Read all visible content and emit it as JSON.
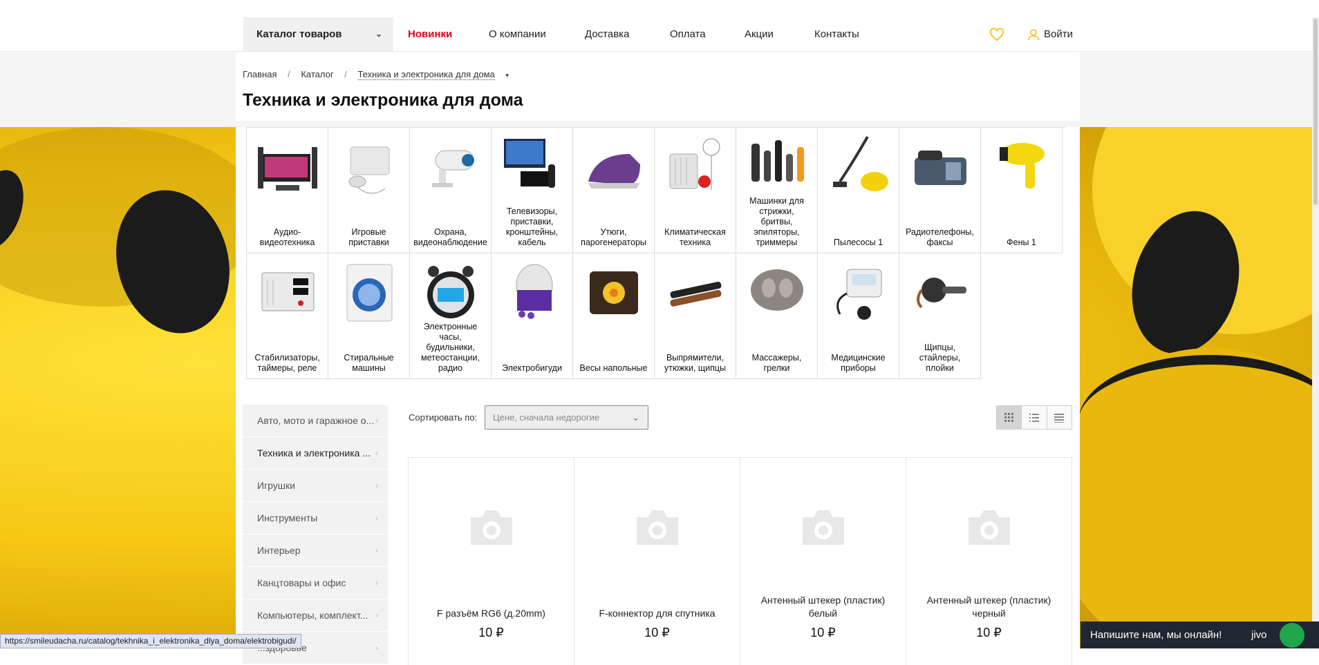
{
  "nav": {
    "catalog_button": "Каталог товаров",
    "links": [
      "Новинки",
      "О компании",
      "Доставка",
      "Оплата",
      "Акции",
      "Контакты"
    ],
    "login": "Войти"
  },
  "breadcrumb": [
    "Главная",
    "Каталог",
    "Техника и электроника для дома"
  ],
  "page_title": "Техника и электроника для дома",
  "categories": [
    {
      "label": "Аудио-\nвидеотехника",
      "icon": "audio-video-icon"
    },
    {
      "label": "Игровые\nприставки",
      "icon": "game-console-icon"
    },
    {
      "label": "Охрана,\nвидеонаблюдение",
      "icon": "security-camera-icon"
    },
    {
      "label": "Телевизоры,\nприставки,\nкронштейны,\nкабель",
      "icon": "tv-icon"
    },
    {
      "label": "Утюги,\nпарогенераторы",
      "icon": "iron-icon"
    },
    {
      "label": "Климатическая\nтехника",
      "icon": "climate-icon"
    },
    {
      "label": "Машинки для\nстрижки,\nбритвы,\nэпиляторы,\nтриммеры",
      "icon": "clipper-icon"
    },
    {
      "label": "Пылесосы 1",
      "icon": "vacuum-icon"
    },
    {
      "label": "Радиотелефоны,\nфаксы",
      "icon": "phone-fax-icon"
    },
    {
      "label": "Фены 1",
      "icon": "hair-dryer-icon"
    },
    {
      "label": "Стабилизаторы,\nтаймеры, реле",
      "icon": "stabilizer-icon"
    },
    {
      "label": "Стиральные\nмашины",
      "icon": "washing-machine-icon"
    },
    {
      "label": "Электронные\nчасы,\nбудильники,\nметеостанции,\nрадио",
      "icon": "alarm-clock-icon"
    },
    {
      "label": "Электробигуди",
      "icon": "hair-curlers-icon"
    },
    {
      "label": "Весы напольные",
      "icon": "floor-scale-icon"
    },
    {
      "label": "Выпрямители,\nутюжки, щипцы",
      "icon": "hair-straightener-icon"
    },
    {
      "label": "Массажеры,\nгрелки",
      "icon": "massager-icon"
    },
    {
      "label": "Медицинские\nприборы",
      "icon": "blood-pressure-icon"
    },
    {
      "label": "Щипцы,\nстайлеры,\nплойки",
      "icon": "curling-iron-icon"
    }
  ],
  "sidebar": [
    "Авто, мото и гаражное о...",
    "Техника и электроника ...",
    "Игрушки",
    "Инструменты",
    "Интерьер",
    "Канцтовары и офис",
    "Компьютеры, комплект...",
    "...здоровье"
  ],
  "sort": {
    "label": "Сортировать по:",
    "value": "Цене, сначала недорогие"
  },
  "products": [
    {
      "name": "F разъём RG6 (д.20mm)",
      "price": "10 ₽"
    },
    {
      "name": "F-коннектор для спутника",
      "price": "10 ₽"
    },
    {
      "name": "Антенный штекер (пластик) белый",
      "price": "10 ₽"
    },
    {
      "name": "Антенный штекер (пластик) черный",
      "price": "10 ₽"
    }
  ],
  "status_url": "https://smileudacha.ru/catalog/tekhnika_i_elektronika_dlya_doma/elektrobigudi/",
  "chat": {
    "text": "Напишите нам, мы онлайн!",
    "brand": "jivo"
  },
  "colors": {
    "accent": "#e1001a",
    "yellow": "#f6c814",
    "chat_bg": "#1f2733"
  }
}
